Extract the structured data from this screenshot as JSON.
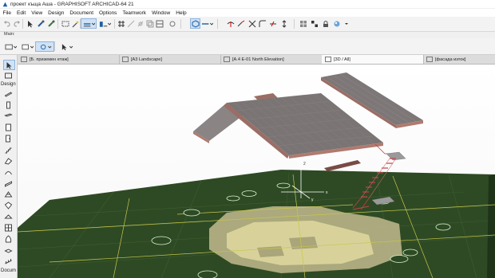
{
  "window": {
    "title": "проект къща Аша - GRAPHISOFT ARCHICAD-64 21"
  },
  "menu": [
    "File",
    "Edit",
    "View",
    "Design",
    "Document",
    "Options",
    "Teamwork",
    "Window",
    "Help"
  ],
  "infobox": {
    "label": "Main:"
  },
  "tabs": [
    {
      "label": "[Б. приземен етаж]"
    },
    {
      "label": "[A3 Landscape]"
    },
    {
      "label": "[A.4 E-01 North Elevation]"
    },
    {
      "label": "[3D / All]",
      "active": true
    },
    {
      "label": "[фасада изток]"
    }
  ],
  "toolbox": {
    "design_label": "Design",
    "docu_label": "Docum"
  },
  "viewport": {
    "model_label": "2",
    "x_axis": "x",
    "y_axis": "y"
  },
  "colors": {
    "roof": "#7a7474",
    "roof_edge": "#b07a6e",
    "grass": "#2e4a24",
    "terrain": "#d8d29a",
    "stair": "#c0404a",
    "selection": "#cfe2f6"
  }
}
